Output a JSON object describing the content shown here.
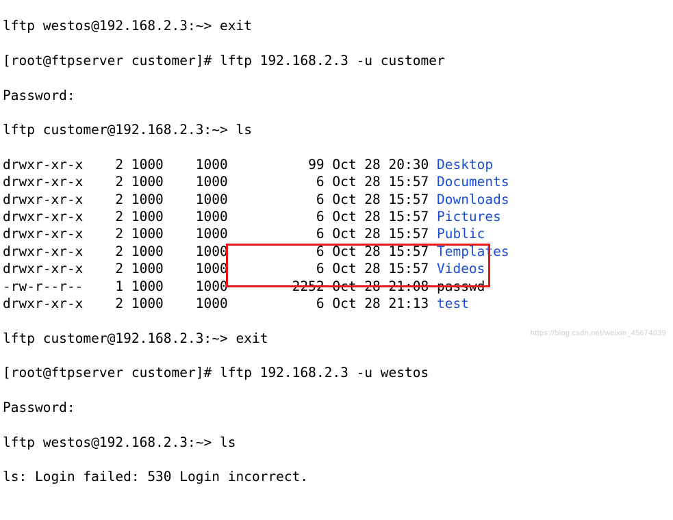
{
  "colors": {
    "dir": "#1a4fd6",
    "highlight": "#e41818"
  },
  "lines": {
    "l0": "lftp westos@192.168.2.3:~> exit",
    "l1_prompt": "[root@ftpserver customer]# ",
    "l1_cmd": "lftp 192.168.2.3 -u customer",
    "l2": "Password:",
    "l3_prompt": "lftp customer@192.168.2.3:~> ",
    "l3_cmd": "ls",
    "exit_prompt": "lftp customer@192.168.2.3:~> ",
    "exit_cmd": "exit",
    "l5_prompt": "[root@ftpserver customer]# ",
    "l5_cmd": "lftp 192.168.2.3 -u westos",
    "l6": "Password:",
    "l7_prompt": "lftp westos@192.168.2.3:~> ",
    "l7_cmd": "ls",
    "l8": "ls: Login failed: 530 Login incorrect."
  },
  "listing": [
    {
      "perm": "drwxr-xr-x",
      "nl": "2",
      "uid": "1000",
      "gid": "1000",
      "size": "99",
      "date": "Oct 28 20:30",
      "name": "Desktop",
      "dir": true
    },
    {
      "perm": "drwxr-xr-x",
      "nl": "2",
      "uid": "1000",
      "gid": "1000",
      "size": "6",
      "date": "Oct 28 15:57",
      "name": "Documents",
      "dir": true
    },
    {
      "perm": "drwxr-xr-x",
      "nl": "2",
      "uid": "1000",
      "gid": "1000",
      "size": "6",
      "date": "Oct 28 15:57",
      "name": "Downloads",
      "dir": true
    },
    {
      "perm": "drwxr-xr-x",
      "nl": "2",
      "uid": "1000",
      "gid": "1000",
      "size": "6",
      "date": "Oct 28 15:57",
      "name": "Pictures",
      "dir": true
    },
    {
      "perm": "drwxr-xr-x",
      "nl": "2",
      "uid": "1000",
      "gid": "1000",
      "size": "6",
      "date": "Oct 28 15:57",
      "name": "Public",
      "dir": true
    },
    {
      "perm": "drwxr-xr-x",
      "nl": "2",
      "uid": "1000",
      "gid": "1000",
      "size": "6",
      "date": "Oct 28 15:57",
      "name": "Templates",
      "dir": true
    },
    {
      "perm": "drwxr-xr-x",
      "nl": "2",
      "uid": "1000",
      "gid": "1000",
      "size": "6",
      "date": "Oct 28 15:57",
      "name": "Videos",
      "dir": true
    },
    {
      "perm": "-rw-r--r--",
      "nl": "1",
      "uid": "1000",
      "gid": "1000",
      "size": "2252",
      "date": "Oct 28 21:08",
      "name": "passwd",
      "dir": false
    },
    {
      "perm": "drwxr-xr-x",
      "nl": "2",
      "uid": "1000",
      "gid": "1000",
      "size": "6",
      "date": "Oct 28 21:13",
      "name": "test",
      "dir": true
    }
  ],
  "watermark": "https://blog.csdn.net/weixin_45674039"
}
